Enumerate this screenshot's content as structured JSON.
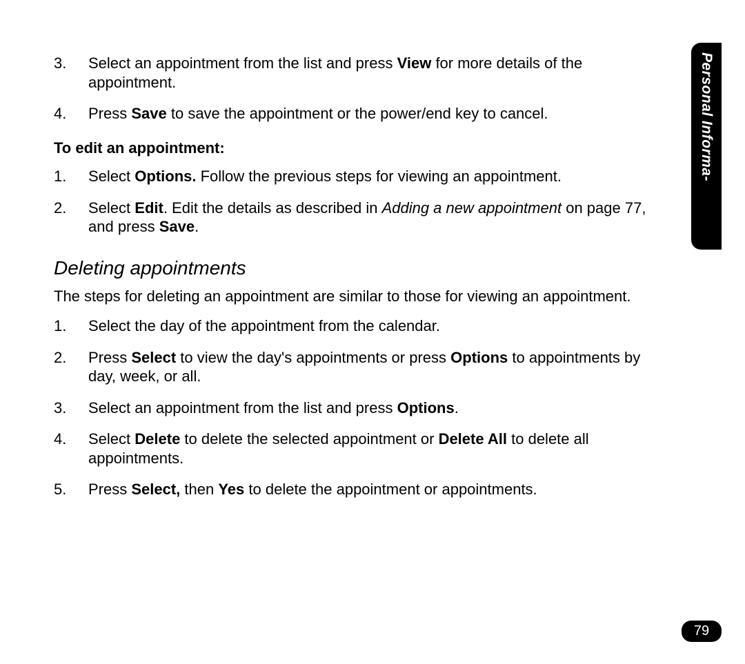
{
  "sideTab": "Personal Informa-",
  "pageNumber": "79",
  "topList": [
    {
      "num": "3.",
      "html": "Select an appointment from the list and press <b>View</b> for more details of the appointment."
    },
    {
      "num": "4.",
      "html": "Press <b>Save</b> to save the appointment or the  power/end key to cancel."
    }
  ],
  "editHeading": "To edit an appointment:",
  "editList": [
    {
      "num": "1.",
      "html": "Select <b>Options.</b> Follow the previous steps for viewing an appointment."
    },
    {
      "num": "2.",
      "html": "Select <b>Edit</b>. Edit the details as described in <i>Adding a new appointment</i> on page 77, and press <b>Save</b>."
    }
  ],
  "sectionTitle": "Deleting appointments",
  "sectionIntro": "The steps for deleting an appointment are similar to those for viewing an appointment.",
  "deleteList": [
    {
      "num": "1.",
      "html": "Select the day of the appointment from the calendar."
    },
    {
      "num": "2.",
      "html": "Press <b>Select</b> to view the day's appointments or press <b>Options</b> to appointments by day, week, or all."
    },
    {
      "num": "3.",
      "html": "Select an appointment from the list and press <b>Options</b>."
    },
    {
      "num": "4.",
      "html": "Select <b>Delete</b> to delete the selected appointment or <b>Delete All</b> to delete all appointments."
    },
    {
      "num": "5.",
      "html": "Press <b>Select,</b> then <b>Yes</b> to delete the appointment or appointments."
    }
  ]
}
